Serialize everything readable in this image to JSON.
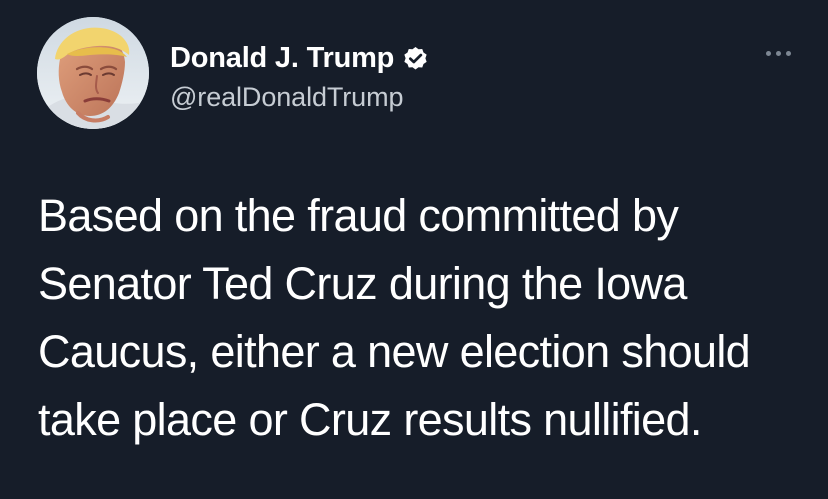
{
  "tweet": {
    "author": {
      "display_name": "Donald J. Trump",
      "handle": "@realDonaldTrump",
      "verified_icon": "verified-badge-icon",
      "avatar_description": "profile photo"
    },
    "more_icon": "more-options-icon",
    "text": "Based on the fraud committed by\nSenator Ted Cruz during the Iowa\nCaucus, either a new election should\ntake place or Cruz results nullified."
  },
  "colors": {
    "background": "#161d29",
    "name_text": "#ffffff",
    "handle_text": "#c6ccd3",
    "body_text": "#ffffff",
    "verified_badge": "#ffffff",
    "more_dots": "#7d8793"
  }
}
